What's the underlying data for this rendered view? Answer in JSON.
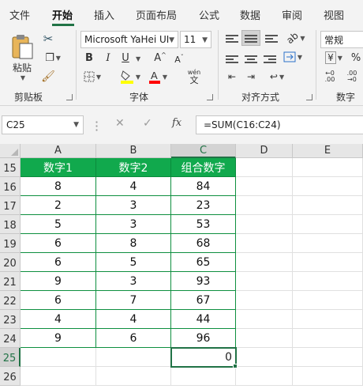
{
  "tabs": [
    "文件",
    "开始",
    "插入",
    "页面布局",
    "公式",
    "数据",
    "审阅",
    "视图"
  ],
  "ribbon": {
    "clipboard": {
      "paste_label": "粘贴",
      "group_label": "剪贴板"
    },
    "font": {
      "name": "Microsoft YaHei UI",
      "size": "11",
      "bold": "B",
      "italic": "I",
      "underline": "U",
      "grow": "A",
      "shrink": "A",
      "phonetic_top": "wén",
      "phonetic_bottom": "文",
      "group_label": "字体",
      "highlight_color": "#ffff00",
      "font_color": "#ff0000"
    },
    "alignment": {
      "group_label": "对齐方式"
    },
    "number": {
      "format": "常规",
      "currency": "¥",
      "percent": "%",
      "group_label": "数字"
    }
  },
  "formula_bar": {
    "name_box": "C25",
    "formula": "=SUM(C16:C24)"
  },
  "sheet": {
    "columns": [
      "A",
      "B",
      "C",
      "D",
      "E"
    ],
    "selected_column": "C",
    "rows": [
      "15",
      "16",
      "17",
      "18",
      "19",
      "20",
      "21",
      "22",
      "23",
      "24",
      "25",
      "26"
    ],
    "selected_row": "25",
    "headers": [
      "数字1",
      "数字2",
      "组合数字"
    ],
    "data": [
      [
        "8",
        "4",
        "84"
      ],
      [
        "2",
        "3",
        "23"
      ],
      [
        "5",
        "3",
        "53"
      ],
      [
        "6",
        "8",
        "68"
      ],
      [
        "6",
        "5",
        "65"
      ],
      [
        "9",
        "3",
        "93"
      ],
      [
        "6",
        "7",
        "67"
      ],
      [
        "4",
        "4",
        "44"
      ],
      [
        "9",
        "6",
        "96"
      ]
    ],
    "active_cell_value": "0",
    "header_fill": "#11a94d",
    "accent": "#217346"
  }
}
